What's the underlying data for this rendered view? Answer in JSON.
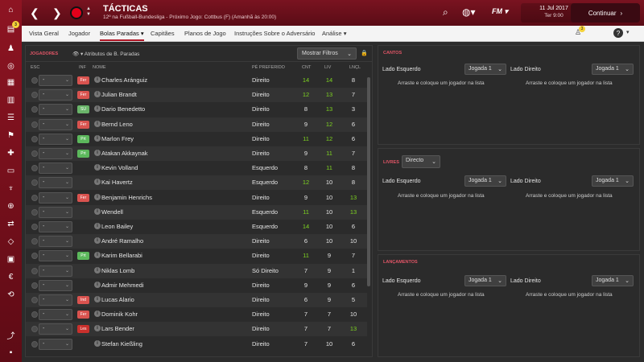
{
  "header": {
    "title": "TÁCTICAS",
    "subtitle": "12º na Fußball-Bundesliga - Próximo Jogo: Cottbus (F) (Amanhã às 20:00)",
    "date_line1": "11 Jul 2017",
    "date_line2": "Ter 9:00",
    "continue_label": "Continuar",
    "fm_label": "FM"
  },
  "sidebar": {
    "notification_count": "3"
  },
  "tabs": {
    "items": [
      "Vista Geral",
      "Jogador",
      "Bolas Paradas",
      "Capitães",
      "Planos de Jogo",
      "Instruções Sobre o Adversário",
      "Análise"
    ],
    "notification_count": "3"
  },
  "players_panel": {
    "title": "JOGADORES",
    "attributes_label": "Atributos de B. Paradas",
    "filter_label": "Mostrar Filtros",
    "columns": {
      "esc": "ESC",
      "inf": "INF",
      "nome": "NOME",
      "pe": "PÉ PREFERIDO",
      "cnt": "CNT",
      "liv": "LIV",
      "lncl": "LNÇL"
    },
    "rows": [
      {
        "sel": "-",
        "badge": "Fer",
        "name": "Charles Aránguiz",
        "foot": "Direito",
        "cnt": "14",
        "liv": "14",
        "lncl": "8"
      },
      {
        "sel": "-",
        "badge": "Fer",
        "name": "Julian Brandt",
        "foot": "Direito",
        "cnt": "12",
        "liv": "13",
        "lncl": "7"
      },
      {
        "sel": "-",
        "badge": "SU",
        "name": "Dario Benedetto",
        "foot": "Direito",
        "cnt": "8",
        "liv": "13",
        "lncl": "3"
      },
      {
        "sel": "-",
        "badge": "Fer",
        "name": "Bernd Leno",
        "foot": "Direito",
        "cnt": "9",
        "liv": "12",
        "lncl": "6"
      },
      {
        "sel": "-",
        "badge": "Prt",
        "name": "Marlon Frey",
        "foot": "Direito",
        "cnt": "11",
        "liv": "12",
        "lncl": "6"
      },
      {
        "sel": "-",
        "badge": "Prt",
        "name": "Atakan Akkaynak",
        "foot": "Direito",
        "cnt": "9",
        "liv": "11",
        "lncl": "7"
      },
      {
        "sel": "-",
        "badge": "",
        "name": "Kevin Volland",
        "foot": "Esquerdo",
        "cnt": "8",
        "liv": "11",
        "lncl": "8"
      },
      {
        "sel": "-",
        "badge": "",
        "name": "Kai Havertz",
        "foot": "Esquerdo",
        "cnt": "12",
        "liv": "10",
        "lncl": "8"
      },
      {
        "sel": "-",
        "badge": "Fer",
        "name": "Benjamin Henrichs",
        "foot": "Direito",
        "cnt": "9",
        "liv": "10",
        "lncl": "13"
      },
      {
        "sel": "-",
        "badge": "",
        "name": "Wendell",
        "foot": "Esquerdo",
        "cnt": "11",
        "liv": "10",
        "lncl": "13"
      },
      {
        "sel": "-",
        "badge": "",
        "name": "Leon Bailey",
        "foot": "Esquerdo",
        "cnt": "14",
        "liv": "10",
        "lncl": "6"
      },
      {
        "sel": "-",
        "badge": "",
        "name": "André Ramalho",
        "foot": "Direito",
        "cnt": "6",
        "liv": "10",
        "lncl": "10"
      },
      {
        "sel": "-",
        "badge": "Prt",
        "name": "Karim Bellarabi",
        "foot": "Direito",
        "cnt": "11",
        "liv": "9",
        "lncl": "7"
      },
      {
        "sel": "-",
        "badge": "",
        "name": "Niklas Lomb",
        "foot": "Só Direito",
        "cnt": "7",
        "liv": "9",
        "lncl": "1"
      },
      {
        "sel": "-",
        "badge": "",
        "name": "Admir Mehmedi",
        "foot": "Direito",
        "cnt": "9",
        "liv": "9",
        "lncl": "6"
      },
      {
        "sel": "-",
        "badge": "Ind",
        "name": "Lucas Alario",
        "foot": "Direito",
        "cnt": "6",
        "liv": "9",
        "lncl": "5"
      },
      {
        "sel": "-",
        "badge": "Fer",
        "name": "Dominik Kohr",
        "foot": "Direito",
        "cnt": "7",
        "liv": "7",
        "lncl": "10"
      },
      {
        "sel": "-",
        "badge": "Les",
        "name": "Lars Bender",
        "foot": "Direito",
        "cnt": "7",
        "liv": "7",
        "lncl": "13"
      },
      {
        "sel": "-",
        "badge": "",
        "name": "Stefan Kießling",
        "foot": "Direito",
        "cnt": "7",
        "liv": "10",
        "lncl": "6"
      }
    ]
  },
  "cantos": {
    "title": "CANTOS",
    "left_label": "Lado Esquerdo",
    "left_value": "Jogada 1",
    "right_label": "Lado Direito",
    "right_value": "Jogada 1",
    "drop_hint": "Arraste e coloque um jogador na lista"
  },
  "livres": {
    "title": "LIVRES",
    "mode_value": "Directo",
    "left_label": "Lado Esquerdo",
    "left_value": "Jogada 1",
    "right_label": "Lado Direito",
    "right_value": "Jogada 1",
    "drop_hint": "Arraste e coloque um jogador na lista"
  },
  "lancamentos": {
    "title": "LANÇAMENTOS",
    "left_label": "Lado Esquerdo",
    "left_value": "Jogada 1",
    "right_label": "Lado Direito",
    "right_value": "Jogada 1",
    "drop_hint": "Arraste e coloque um jogador na lista"
  },
  "colors": {
    "accent": "#b01727",
    "section_title": "#e05566",
    "high_value": "#7ed321",
    "badge_fer": "#d9534f",
    "badge_prt": "#5cb85c",
    "badge_su": "#6ab56a"
  }
}
